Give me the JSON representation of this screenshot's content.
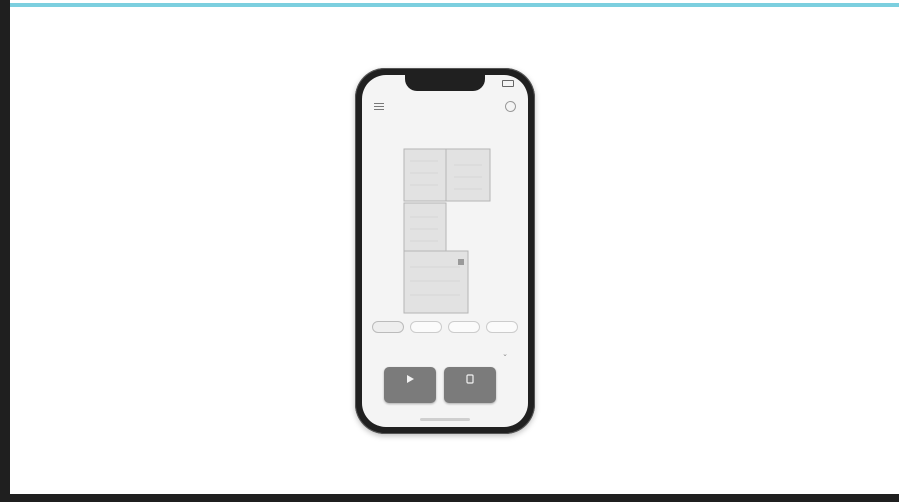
{
  "colors": {
    "accent_bar": "#7ccfdf",
    "frame": "#1f1f1f",
    "phone_body": "#202020",
    "screen_bg": "#f4f4f4",
    "button_bg": "#7b7b7b"
  },
  "status_bar": {
    "time": "",
    "battery_icon": "battery-icon"
  },
  "nav": {
    "menu_icon": "hamburger-menu-icon",
    "title": "",
    "settings_icon": "settings-icon"
  },
  "map": {
    "caption": "",
    "rooms": 4
  },
  "room_tabs": [
    {
      "label": ""
    },
    {
      "label": ""
    },
    {
      "label": ""
    },
    {
      "label": ""
    }
  ],
  "mode": {
    "label": "",
    "chevron_icon": "chevron-down-icon"
  },
  "actions": [
    {
      "label": "",
      "icon": "play-icon"
    },
    {
      "label": "",
      "icon": "dock-icon"
    }
  ]
}
